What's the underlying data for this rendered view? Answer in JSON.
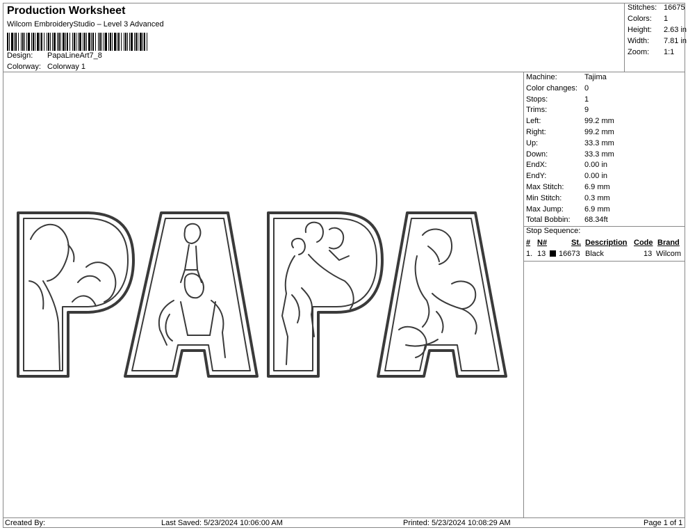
{
  "header": {
    "title": "Production Worksheet",
    "subtitle": "Wilcom EmbroideryStudio – Level 3 Advanced",
    "design_label": "Design:",
    "design_value": "PapaLineArt7_8",
    "colorway_label": "Colorway:",
    "colorway_value": "Colorway 1"
  },
  "summary": [
    {
      "label": "Stitches:",
      "value": "16675"
    },
    {
      "label": "Colors:",
      "value": "1"
    },
    {
      "label": "Height:",
      "value": "2.63 in"
    },
    {
      "label": "Width:",
      "value": "7.81 in"
    },
    {
      "label": "Zoom:",
      "value": "1:1"
    }
  ],
  "machine": [
    {
      "label": "Machine:",
      "value": "Tajima"
    },
    {
      "label": "Color changes:",
      "value": "0"
    },
    {
      "label": "Stops:",
      "value": "1"
    },
    {
      "label": "Trims:",
      "value": "9"
    },
    {
      "label": "Left:",
      "value": "99.2 mm"
    },
    {
      "label": "Right:",
      "value": "99.2 mm"
    },
    {
      "label": "Up:",
      "value": "33.3 mm"
    },
    {
      "label": "Down:",
      "value": "33.3 mm"
    },
    {
      "label": "EndX:",
      "value": "0.00 in"
    },
    {
      "label": "EndY:",
      "value": "0.00 in"
    },
    {
      "label": "Max Stitch:",
      "value": "6.9 mm"
    },
    {
      "label": "Min Stitch:",
      "value": "0.3 mm"
    },
    {
      "label": "Max Jump:",
      "value": "6.9 mm"
    },
    {
      "label": "Total Bobbin:",
      "value": "68.34ft"
    }
  ],
  "stop_sequence": {
    "title": "Stop Sequence:",
    "headers": {
      "num": "#",
      "n": "N#",
      "st": "St.",
      "desc": "Description",
      "code": "Code",
      "brand": "Brand"
    },
    "rows": [
      {
        "num": "1.",
        "n": "13",
        "st": "16673",
        "desc": "Black",
        "code": "13",
        "brand": "Wilcom",
        "color": "#000000"
      }
    ]
  },
  "footer": {
    "created_by": "Created By:",
    "last_saved": "Last Saved: 5/23/2024 10:06:00 AM",
    "printed": "Printed: 5/23/2024 10:08:29 AM",
    "page": "Page 1 of 1"
  },
  "design_preview": {
    "letters": [
      "P",
      "A",
      "P",
      "A"
    ],
    "thread_color": "#3a3a3a"
  }
}
